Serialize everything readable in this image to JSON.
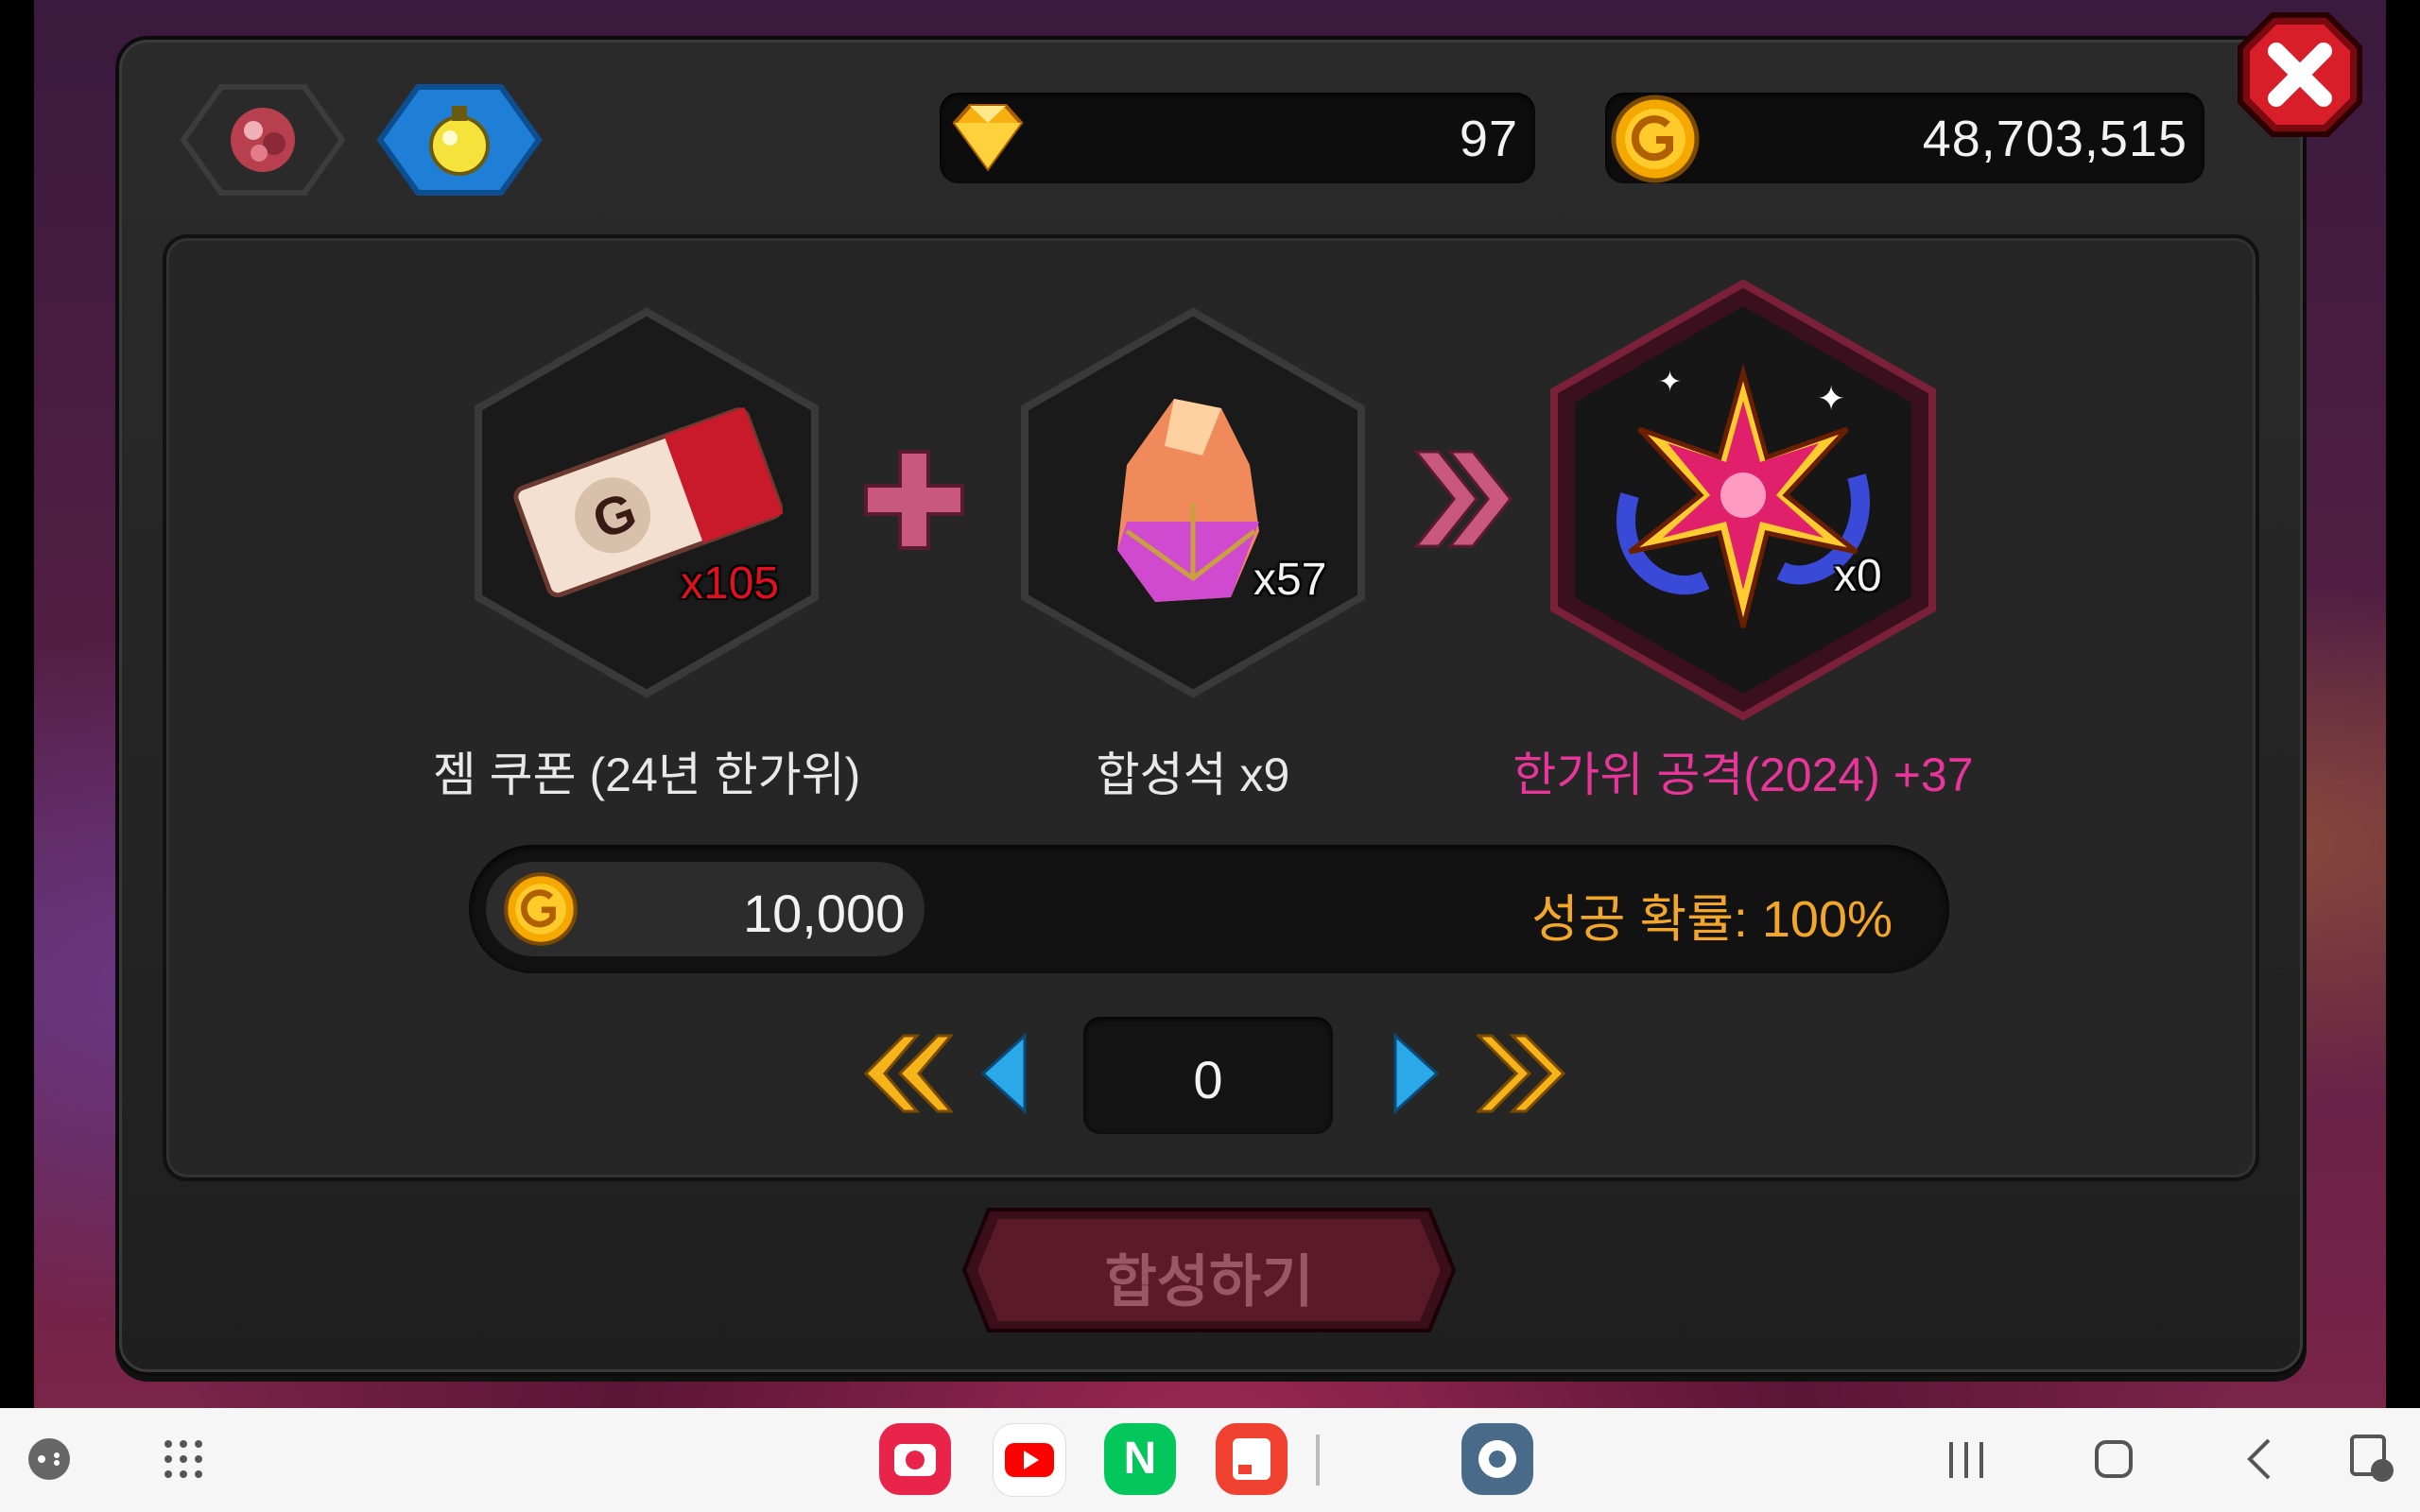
{
  "currency": {
    "gems": "97",
    "gold": "48,703,515"
  },
  "recipe": {
    "ingredient1": {
      "label": "젬 쿠폰 (24년 한가위)",
      "qty": "x105"
    },
    "ingredient2": {
      "label": "합성석 x9",
      "qty": "x57"
    },
    "result": {
      "label": "한가위 공격(2024) +37",
      "qty": "x0"
    }
  },
  "cost": {
    "gold": "10,000",
    "success_rate": "성공 확률: 100%"
  },
  "stepper": {
    "count": "0"
  },
  "synthesize_button": "합성하기",
  "colors": {
    "gold_text": "#f3a72a",
    "result_text": "#e8359a",
    "qty_red": "#e01020",
    "panel": "#262626"
  },
  "taskbar": {
    "apps": [
      "camera-app-icon",
      "youtube-app-icon",
      "naver-app-icon",
      "notes-app-icon",
      "settings-app-icon"
    ],
    "naver_letter": "N"
  }
}
